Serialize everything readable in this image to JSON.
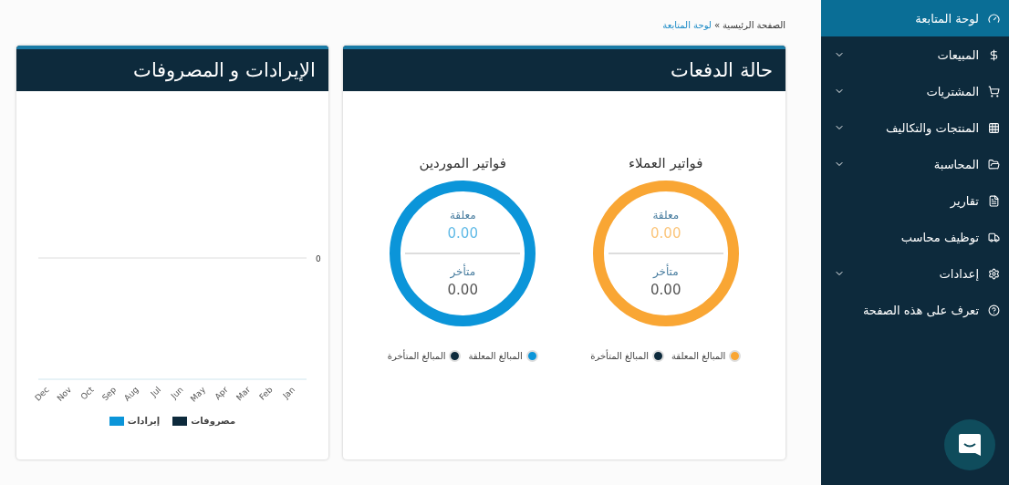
{
  "sidebar": {
    "items": [
      {
        "label": "لوحة المتابعة",
        "selected": true,
        "expandable": false
      },
      {
        "label": "المبيعات",
        "selected": false,
        "expandable": true
      },
      {
        "label": "المشتريات",
        "selected": false,
        "expandable": true
      },
      {
        "label": "المنتجات والتكاليف",
        "selected": false,
        "expandable": true
      },
      {
        "label": "المحاسبة",
        "selected": false,
        "expandable": true
      },
      {
        "label": "تقارير",
        "selected": false,
        "expandable": false
      },
      {
        "label": "توظيف محاسب",
        "selected": false,
        "expandable": false
      },
      {
        "label": "إعدادات",
        "selected": false,
        "expandable": true
      },
      {
        "label": "تعرف على هذه الصفحة",
        "selected": false,
        "expandable": false
      }
    ]
  },
  "breadcrumb": {
    "home": "الصفحة الرئيسية",
    "separator": "»",
    "current": "لوحة المتابعة"
  },
  "payments_card": {
    "title": "حالة الدفعات",
    "groups": [
      {
        "title": "فواتير العملاء",
        "color": "#f9a634",
        "pending_label": "معلقة",
        "pending_value": "0.00",
        "overdue_label": "متأخر",
        "overdue_value": "0.00",
        "legend": [
          {
            "label": "المبالغ المعلقة",
            "color": "#f9a634"
          },
          {
            "label": "المبالغ المتأخرة",
            "color": "#0d2a3c"
          }
        ]
      },
      {
        "title": "فواتير الموردين",
        "color": "#0b95d9",
        "pending_label": "معلقة",
        "pending_value": "0.00",
        "overdue_label": "متأخر",
        "overdue_value": "0.00",
        "legend": [
          {
            "label": "المبالغ المعلقة",
            "color": "#0b95d9"
          },
          {
            "label": "المبالغ المتأخرة",
            "color": "#0d2a3c"
          }
        ]
      }
    ]
  },
  "revenue_card": {
    "title": "الإيرادات و المصروفات",
    "axis_value": "0",
    "months": [
      "Jan",
      "Feb",
      "Mar",
      "Apr",
      "May",
      "Jun",
      "Jul",
      "Aug",
      "Sep",
      "Oct",
      "Nov",
      "Dec"
    ],
    "legend": [
      {
        "label": "مصروفات",
        "color": "#0d2a3c"
      },
      {
        "label": "إيرادات",
        "color": "#0b95d9"
      }
    ]
  }
}
